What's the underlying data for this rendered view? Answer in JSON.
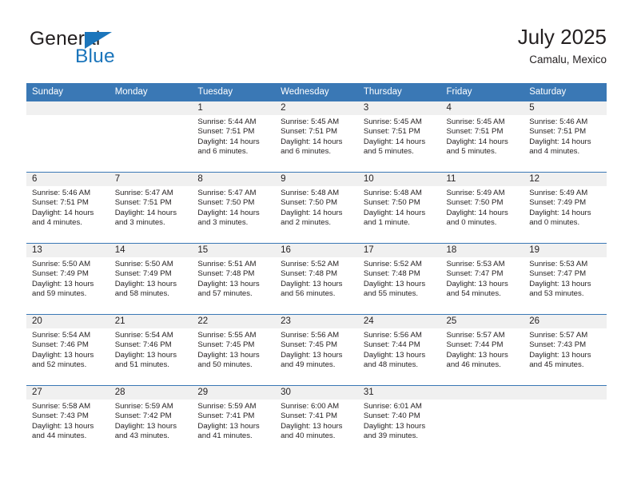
{
  "brand": {
    "name_part1": "General",
    "name_part2": "Blue",
    "accent_color": "#1b75bb"
  },
  "header": {
    "title": "July 2025",
    "location": "Camalu, Mexico",
    "header_blue": "#3a78b5",
    "daynum_band_color": "#f0f0f0"
  },
  "weekday_headers": [
    "Sunday",
    "Monday",
    "Tuesday",
    "Wednesday",
    "Thursday",
    "Friday",
    "Saturday"
  ],
  "labels": {
    "sunrise_prefix": "Sunrise:",
    "sunset_prefix": "Sunset:",
    "daylight_prefix": "Daylight:"
  },
  "weeks": [
    [
      {
        "empty": true,
        "day": ""
      },
      {
        "empty": true,
        "day": ""
      },
      {
        "day": "1",
        "sunrise": "Sunrise: 5:44 AM",
        "sunset": "Sunset: 7:51 PM",
        "daylight_line1": "Daylight: 14 hours",
        "daylight_line2": "and 6 minutes."
      },
      {
        "day": "2",
        "sunrise": "Sunrise: 5:45 AM",
        "sunset": "Sunset: 7:51 PM",
        "daylight_line1": "Daylight: 14 hours",
        "daylight_line2": "and 6 minutes."
      },
      {
        "day": "3",
        "sunrise": "Sunrise: 5:45 AM",
        "sunset": "Sunset: 7:51 PM",
        "daylight_line1": "Daylight: 14 hours",
        "daylight_line2": "and 5 minutes."
      },
      {
        "day": "4",
        "sunrise": "Sunrise: 5:45 AM",
        "sunset": "Sunset: 7:51 PM",
        "daylight_line1": "Daylight: 14 hours",
        "daylight_line2": "and 5 minutes."
      },
      {
        "day": "5",
        "sunrise": "Sunrise: 5:46 AM",
        "sunset": "Sunset: 7:51 PM",
        "daylight_line1": "Daylight: 14 hours",
        "daylight_line2": "and 4 minutes."
      }
    ],
    [
      {
        "day": "6",
        "sunrise": "Sunrise: 5:46 AM",
        "sunset": "Sunset: 7:51 PM",
        "daylight_line1": "Daylight: 14 hours",
        "daylight_line2": "and 4 minutes."
      },
      {
        "day": "7",
        "sunrise": "Sunrise: 5:47 AM",
        "sunset": "Sunset: 7:51 PM",
        "daylight_line1": "Daylight: 14 hours",
        "daylight_line2": "and 3 minutes."
      },
      {
        "day": "8",
        "sunrise": "Sunrise: 5:47 AM",
        "sunset": "Sunset: 7:50 PM",
        "daylight_line1": "Daylight: 14 hours",
        "daylight_line2": "and 3 minutes."
      },
      {
        "day": "9",
        "sunrise": "Sunrise: 5:48 AM",
        "sunset": "Sunset: 7:50 PM",
        "daylight_line1": "Daylight: 14 hours",
        "daylight_line2": "and 2 minutes."
      },
      {
        "day": "10",
        "sunrise": "Sunrise: 5:48 AM",
        "sunset": "Sunset: 7:50 PM",
        "daylight_line1": "Daylight: 14 hours",
        "daylight_line2": "and 1 minute."
      },
      {
        "day": "11",
        "sunrise": "Sunrise: 5:49 AM",
        "sunset": "Sunset: 7:50 PM",
        "daylight_line1": "Daylight: 14 hours",
        "daylight_line2": "and 0 minutes."
      },
      {
        "day": "12",
        "sunrise": "Sunrise: 5:49 AM",
        "sunset": "Sunset: 7:49 PM",
        "daylight_line1": "Daylight: 14 hours",
        "daylight_line2": "and 0 minutes."
      }
    ],
    [
      {
        "day": "13",
        "sunrise": "Sunrise: 5:50 AM",
        "sunset": "Sunset: 7:49 PM",
        "daylight_line1": "Daylight: 13 hours",
        "daylight_line2": "and 59 minutes."
      },
      {
        "day": "14",
        "sunrise": "Sunrise: 5:50 AM",
        "sunset": "Sunset: 7:49 PM",
        "daylight_line1": "Daylight: 13 hours",
        "daylight_line2": "and 58 minutes."
      },
      {
        "day": "15",
        "sunrise": "Sunrise: 5:51 AM",
        "sunset": "Sunset: 7:48 PM",
        "daylight_line1": "Daylight: 13 hours",
        "daylight_line2": "and 57 minutes."
      },
      {
        "day": "16",
        "sunrise": "Sunrise: 5:52 AM",
        "sunset": "Sunset: 7:48 PM",
        "daylight_line1": "Daylight: 13 hours",
        "daylight_line2": "and 56 minutes."
      },
      {
        "day": "17",
        "sunrise": "Sunrise: 5:52 AM",
        "sunset": "Sunset: 7:48 PM",
        "daylight_line1": "Daylight: 13 hours",
        "daylight_line2": "and 55 minutes."
      },
      {
        "day": "18",
        "sunrise": "Sunrise: 5:53 AM",
        "sunset": "Sunset: 7:47 PM",
        "daylight_line1": "Daylight: 13 hours",
        "daylight_line2": "and 54 minutes."
      },
      {
        "day": "19",
        "sunrise": "Sunrise: 5:53 AM",
        "sunset": "Sunset: 7:47 PM",
        "daylight_line1": "Daylight: 13 hours",
        "daylight_line2": "and 53 minutes."
      }
    ],
    [
      {
        "day": "20",
        "sunrise": "Sunrise: 5:54 AM",
        "sunset": "Sunset: 7:46 PM",
        "daylight_line1": "Daylight: 13 hours",
        "daylight_line2": "and 52 minutes."
      },
      {
        "day": "21",
        "sunrise": "Sunrise: 5:54 AM",
        "sunset": "Sunset: 7:46 PM",
        "daylight_line1": "Daylight: 13 hours",
        "daylight_line2": "and 51 minutes."
      },
      {
        "day": "22",
        "sunrise": "Sunrise: 5:55 AM",
        "sunset": "Sunset: 7:45 PM",
        "daylight_line1": "Daylight: 13 hours",
        "daylight_line2": "and 50 minutes."
      },
      {
        "day": "23",
        "sunrise": "Sunrise: 5:56 AM",
        "sunset": "Sunset: 7:45 PM",
        "daylight_line1": "Daylight: 13 hours",
        "daylight_line2": "and 49 minutes."
      },
      {
        "day": "24",
        "sunrise": "Sunrise: 5:56 AM",
        "sunset": "Sunset: 7:44 PM",
        "daylight_line1": "Daylight: 13 hours",
        "daylight_line2": "and 48 minutes."
      },
      {
        "day": "25",
        "sunrise": "Sunrise: 5:57 AM",
        "sunset": "Sunset: 7:44 PM",
        "daylight_line1": "Daylight: 13 hours",
        "daylight_line2": "and 46 minutes."
      },
      {
        "day": "26",
        "sunrise": "Sunrise: 5:57 AM",
        "sunset": "Sunset: 7:43 PM",
        "daylight_line1": "Daylight: 13 hours",
        "daylight_line2": "and 45 minutes."
      }
    ],
    [
      {
        "day": "27",
        "sunrise": "Sunrise: 5:58 AM",
        "sunset": "Sunset: 7:43 PM",
        "daylight_line1": "Daylight: 13 hours",
        "daylight_line2": "and 44 minutes."
      },
      {
        "day": "28",
        "sunrise": "Sunrise: 5:59 AM",
        "sunset": "Sunset: 7:42 PM",
        "daylight_line1": "Daylight: 13 hours",
        "daylight_line2": "and 43 minutes."
      },
      {
        "day": "29",
        "sunrise": "Sunrise: 5:59 AM",
        "sunset": "Sunset: 7:41 PM",
        "daylight_line1": "Daylight: 13 hours",
        "daylight_line2": "and 41 minutes."
      },
      {
        "day": "30",
        "sunrise": "Sunrise: 6:00 AM",
        "sunset": "Sunset: 7:41 PM",
        "daylight_line1": "Daylight: 13 hours",
        "daylight_line2": "and 40 minutes."
      },
      {
        "day": "31",
        "sunrise": "Sunrise: 6:01 AM",
        "sunset": "Sunset: 7:40 PM",
        "daylight_line1": "Daylight: 13 hours",
        "daylight_line2": "and 39 minutes."
      },
      {
        "empty": true,
        "day": ""
      },
      {
        "empty": true,
        "day": ""
      }
    ]
  ]
}
